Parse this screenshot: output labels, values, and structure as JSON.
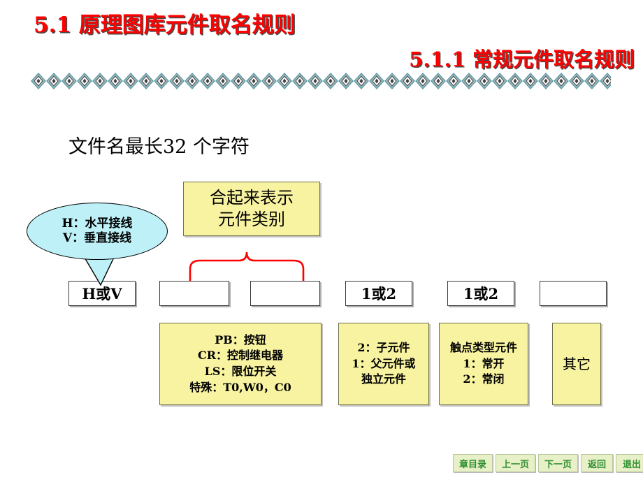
{
  "slide": {
    "title_main": "5.1 原理图库元件取名规则",
    "title_sub": "5.1.1 常规元件取名规则",
    "caption": "文件名最长32 个字符",
    "accent_color": "#ff0000",
    "callout_fill": "#bdf0f7",
    "yellow_fill": "#f8f3a0",
    "brace_color": "#ff0000"
  },
  "callout": {
    "line1": "H：水平接线",
    "line2": "V：垂直接线"
  },
  "category_box": {
    "line1": "合起来表示",
    "line2": "元件类别"
  },
  "slots": [
    {
      "label": "H或V"
    },
    {
      "label": ""
    },
    {
      "label": ""
    },
    {
      "label": "1或2"
    },
    {
      "label": "1或2"
    },
    {
      "label": ""
    }
  ],
  "descriptions": [
    {
      "name": "component-type-legend",
      "lines": [
        "PB：按钮",
        "CR：控制继电器",
        "LS：限位开关",
        "特殊：T0,W0，C0"
      ]
    },
    {
      "name": "parent-child-legend",
      "lines": [
        "2：子元件",
        "1：父元件或",
        "独立元件"
      ]
    },
    {
      "name": "contact-type-legend",
      "lines": [
        "触点类型元件",
        "1：常开",
        "2：常闭"
      ]
    },
    {
      "name": "other-legend",
      "lines": [
        "其它"
      ]
    }
  ],
  "nav_buttons": [
    {
      "label": "章目录"
    },
    {
      "label": "上一页"
    },
    {
      "label": "下一页"
    },
    {
      "label": "返回"
    },
    {
      "label": "退出"
    }
  ]
}
